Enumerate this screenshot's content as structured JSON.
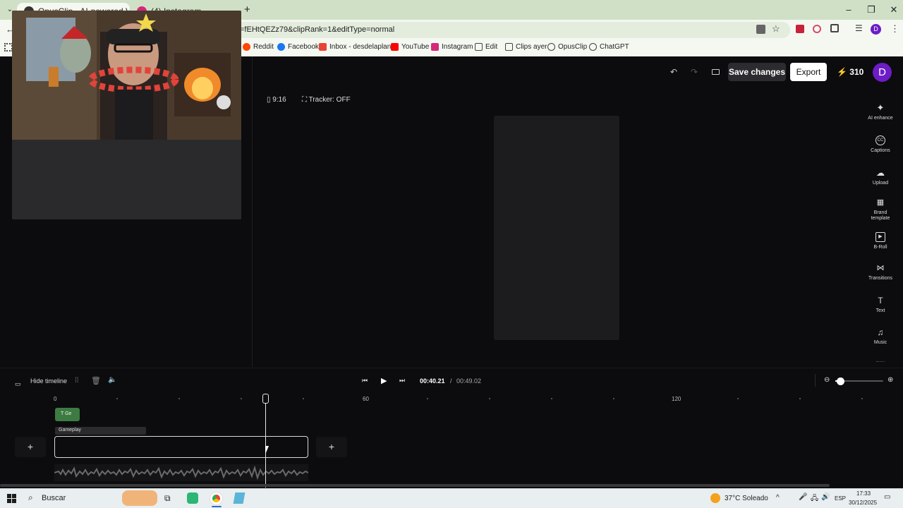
{
  "browser": {
    "tabs": [
      {
        "title": "OpusClip - AI-powered Video R",
        "active": true
      },
      {
        "title": "(4) Instagram",
        "active": false
      }
    ],
    "url": "=fEHtQEZz79&clipRank=1&editType=normal",
    "bookmarks": [
      "Reddit",
      "Facebook",
      "Inbox - desdelaplan...",
      "YouTube",
      "Instagram",
      "Edit",
      "Clips ayer",
      "OpusClip",
      "ChatGPT"
    ],
    "profile_initial": "D"
  },
  "toolbar": {
    "save_label": "Save changes",
    "export_label": "Export",
    "credits": "310",
    "avatar_initial": "D"
  },
  "preview": {
    "aspect_ratio": "9:16",
    "tracker": "Tracker: OFF"
  },
  "rail": {
    "items": [
      "AI enhance",
      "Captions",
      "Upload",
      "Brand template",
      "B-Roll",
      "Transitions",
      "Text",
      "Music"
    ]
  },
  "timeline": {
    "hide_label": "Hide timeline",
    "current_time": "00:40.21",
    "separator": "/",
    "total_time": "00:49.02",
    "ruler_labels": [
      "0",
      "60",
      "120"
    ],
    "caption_chip": "Ge",
    "track_label": "Gameplay",
    "add_label": "+"
  },
  "taskbar": {
    "search_placeholder": "Buscar",
    "weather": "37°C Soleado",
    "lang": "ESP",
    "time": "17:33",
    "date": "30/12/2025"
  },
  "colors": {
    "accent_purple": "#6d1cc6",
    "caption_green": "#3d7b42",
    "chrome_green": "#dfe9d8",
    "app_bg": "#0c0c0e"
  }
}
